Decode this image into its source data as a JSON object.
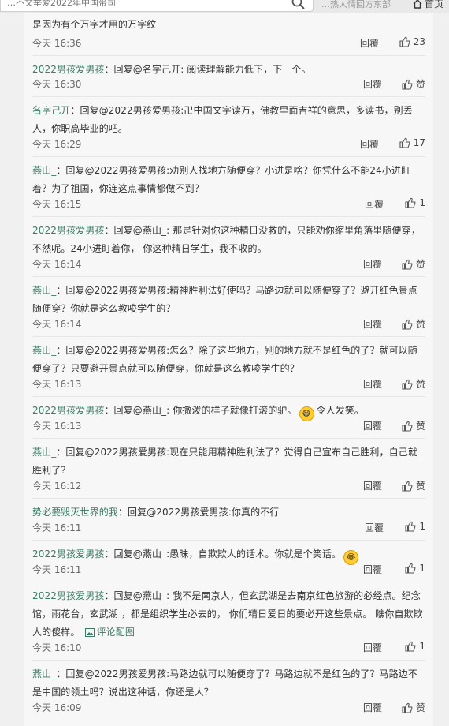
{
  "top": {
    "search_placeholder": "…不文举爱2022年中国带司",
    "hot_links": "…热人情回方东部",
    "home_label": "首页"
  },
  "comments": [
    {
      "segments": [
        {
          "t": "是因为有个万字才用的万字纹"
        }
      ],
      "time": "今天 16:36",
      "reply": "回覆",
      "likes": "23"
    },
    {
      "segments": [
        {
          "t": "2022男孩爱男孩",
          "u": true
        },
        {
          "t": "：回复@名字己开: 阅读理解能力低下，下一个。"
        }
      ],
      "time": "今天 16:30",
      "reply": "回覆",
      "likes": "赞"
    },
    {
      "segments": [
        {
          "t": "名字己开",
          "u": true
        },
        {
          "t": "：回复@2022男孩爱男孩:卍中国文字读万，佛教里面吉祥的意思，多读书，别丢人，你职高毕业的吧。"
        }
      ],
      "time": "今天 16:29",
      "reply": "回覆",
      "likes": "17"
    },
    {
      "segments": [
        {
          "t": "燕山_",
          "u": true
        },
        {
          "t": "：回复@2022男孩爱男孩:劝别人找地方随便穿？小进是啥？你凭什么不能24小进盯着？为了祖国，你连这点事情都做不到？"
        }
      ],
      "time": "今天 16:15",
      "reply": "回覆",
      "likes": "1"
    },
    {
      "segments": [
        {
          "t": "2022男孩爱男孩",
          "u": true
        },
        {
          "t": "：回复@燕山_: 那是针对你这种精日没救的，只能劝你缩里角落里随便穿，不然呢。24小进盯着你， 你这种精日学生，我不收的。"
        }
      ],
      "time": "今天 16:14",
      "reply": "回覆",
      "likes": "赞"
    },
    {
      "segments": [
        {
          "t": "燕山_",
          "u": true
        },
        {
          "t": "：回复@2022男孩爱男孩:精神胜利法好使吗？马路边就可以随便穿了？避开红色景点随便穿？你就是这么教唆学生的？"
        }
      ],
      "time": "今天 16:14",
      "reply": "回覆",
      "likes": "赞"
    },
    {
      "segments": [
        {
          "t": "燕山_",
          "u": true
        },
        {
          "t": "：回复@2022男孩爱男孩:怎么？除了这些地方，别的地方就不是红色的了？就可以随便穿了？只要避开景点就可以随便穿，你就是这么教唆学生的？"
        }
      ],
      "time": "今天 16:13",
      "reply": "回覆",
      "likes": "赞"
    },
    {
      "segments": [
        {
          "t": "2022男孩爱男孩",
          "u": true
        },
        {
          "t": "：回复@燕山_: 你撒泼的样子就像打滚的驴。"
        },
        {
          "e": "😷"
        },
        {
          "t": "令人发笑。"
        }
      ],
      "time": "今天 16:13",
      "reply": "回覆",
      "likes": "赞"
    },
    {
      "segments": [
        {
          "t": "燕山_",
          "u": true
        },
        {
          "t": "：回复@2022男孩爱男孩:现在只能用精神胜利法了？觉得自己宣布自己胜利，自己就胜利了？"
        }
      ],
      "time": "今天 16:12",
      "reply": "回覆",
      "likes": "赞"
    },
    {
      "segments": [
        {
          "t": "势必要毁灭世界的我",
          "u": true
        },
        {
          "t": "：回复@2022男孩爱男孩:你真的不行"
        }
      ],
      "time": "今天 16:11",
      "reply": "回覆",
      "likes": "1"
    },
    {
      "segments": [
        {
          "t": "2022男孩爱男孩",
          "u": true
        },
        {
          "t": "：回复@燕山_:愚昧，自欺欺人的话术。你就是个笑话。"
        },
        {
          "e": "😂"
        }
      ],
      "time": "今天 16:11",
      "reply": "回覆",
      "likes": "1"
    },
    {
      "segments": [
        {
          "t": "2022男孩爱男孩",
          "u": true
        },
        {
          "t": "：回复@燕山_: 我不是南京人，但玄武湖是去南京红色旅游的必经点。纪念馆，雨花台，玄武湖 ，都是组织学生必去的， 你们精日爱日的要必开这些景点。 瞧你自欺欺人的傻样。"
        },
        {
          "p": "评论配图"
        }
      ],
      "time": "今天 16:10",
      "reply": "回覆",
      "likes": "1"
    },
    {
      "segments": [
        {
          "t": "燕山_",
          "u": true
        },
        {
          "t": "：回复@2022男孩爱男孩:马路边就可以随便穿了？马路边就不是红色的了？马路边不是中国的领土吗？说出这种话，你还是人？"
        }
      ],
      "time": "今天 16:09",
      "reply": "回覆",
      "likes": "赞"
    }
  ]
}
